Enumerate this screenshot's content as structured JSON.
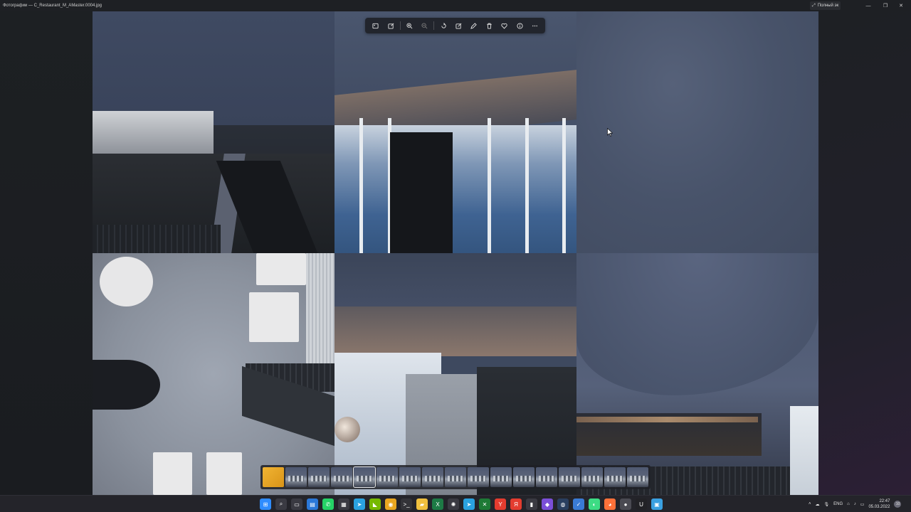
{
  "window": {
    "title": "Фотографии — C_Restaurant_M_AMaster.0004.jpg",
    "fullscreen_label": "Полный эк",
    "controls": [
      "minimize",
      "maximize",
      "close"
    ]
  },
  "toolbar": {
    "buttons": [
      {
        "icon": "image-view-icon",
        "enabled": true
      },
      {
        "icon": "edit-image-icon",
        "enabled": true
      },
      {
        "icon": "zoom-in-icon",
        "enabled": true
      },
      {
        "icon": "zoom-out-icon",
        "enabled": false
      },
      {
        "icon": "rotate-icon",
        "enabled": true
      },
      {
        "icon": "crop-edit-icon",
        "enabled": true
      },
      {
        "icon": "draw-icon",
        "enabled": true
      },
      {
        "icon": "delete-icon",
        "enabled": true
      },
      {
        "icon": "favorite-icon",
        "enabled": true
      },
      {
        "icon": "info-icon",
        "enabled": true
      },
      {
        "icon": "more-icon",
        "enabled": true
      }
    ]
  },
  "filmstrip": {
    "thumbnail_count": 17,
    "selected_index": 4
  },
  "taskbar": {
    "apps": [
      {
        "icon": "windows-start-icon",
        "color": "#2f8cff",
        "glyph": "⊞"
      },
      {
        "icon": "search-icon",
        "color": "#3a3a42",
        "glyph": "⌕"
      },
      {
        "icon": "task-view-icon",
        "color": "#3a3a42",
        "glyph": "▭"
      },
      {
        "icon": "files-icon",
        "color": "#2b78d8",
        "glyph": "▤"
      },
      {
        "icon": "whatsapp-icon",
        "color": "#25d366",
        "glyph": "✆"
      },
      {
        "icon": "calendar-icon",
        "color": "#3a3a42",
        "glyph": "▦"
      },
      {
        "icon": "telegram-icon",
        "color": "#2aa2e0",
        "glyph": "➤"
      },
      {
        "icon": "nvidia-icon",
        "color": "#76b900",
        "glyph": "◣"
      },
      {
        "icon": "chrome-icon",
        "color": "#e9a620",
        "glyph": "◉"
      },
      {
        "icon": "terminal-icon",
        "color": "#333338",
        "glyph": ">_"
      },
      {
        "icon": "folder-icon",
        "color": "#f0c03e",
        "glyph": "▰"
      },
      {
        "icon": "excel-icon",
        "color": "#1d7a45",
        "glyph": "X"
      },
      {
        "icon": "openai-icon",
        "color": "#3a3a42",
        "glyph": "✺"
      },
      {
        "icon": "telegram-alt-icon",
        "color": "#2aa2e0",
        "glyph": "➤"
      },
      {
        "icon": "xbox-icon",
        "color": "#1d7a35",
        "glyph": "✕"
      },
      {
        "icon": "yandex-icon",
        "color": "#e43c2f",
        "glyph": "Y"
      },
      {
        "icon": "yandex-browser-icon",
        "color": "#e43c2f",
        "glyph": "Я"
      },
      {
        "icon": "bookmark-icon",
        "color": "#3a3a42",
        "glyph": "▮"
      },
      {
        "icon": "app-purple-icon",
        "color": "#7b4fd8",
        "glyph": "◆"
      },
      {
        "icon": "steam-icon",
        "color": "#2a3f5f",
        "glyph": "◍"
      },
      {
        "icon": "vpn-icon",
        "color": "#3a7bd5",
        "glyph": "✓"
      },
      {
        "icon": "android-icon",
        "color": "#3ddc84",
        "glyph": "◐"
      },
      {
        "icon": "firefox-icon",
        "color": "#ff7139",
        "glyph": "◕"
      },
      {
        "icon": "app-round-icon",
        "color": "#4a4a52",
        "glyph": "●"
      },
      {
        "icon": "unreal-icon",
        "color": "#222226",
        "glyph": "U"
      },
      {
        "icon": "photos-icon",
        "color": "#3aa0e0",
        "glyph": "▣"
      }
    ],
    "tray": {
      "language": "ENG",
      "time": "22:47",
      "date": "05.03.2022",
      "notifications": "10"
    }
  },
  "colors": {
    "toolbar_bg": "#202228",
    "taskbar_bg": "#24242a",
    "accent_thumb": "#f1b433"
  }
}
